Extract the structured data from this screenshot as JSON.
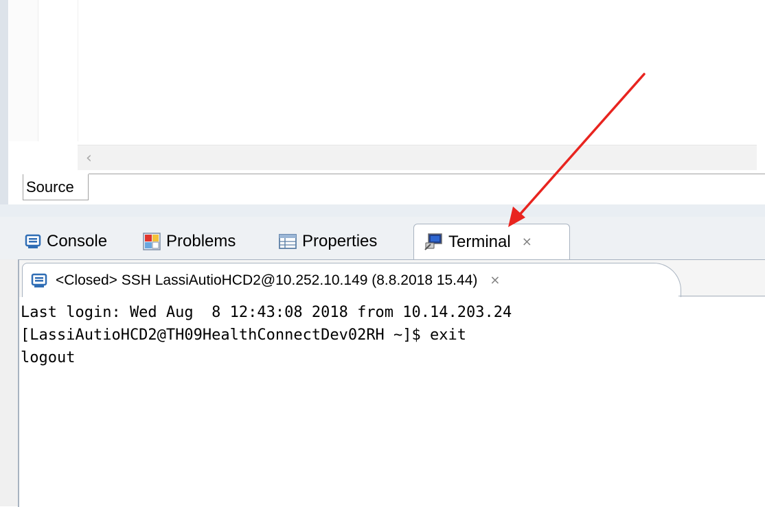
{
  "editor": {
    "scroll_left_glyph": "‹",
    "source_tab_label": "Source"
  },
  "views": {
    "tabs": [
      {
        "label": "Console",
        "icon": "console-icon"
      },
      {
        "label": "Problems",
        "icon": "problems-icon"
      },
      {
        "label": "Properties",
        "icon": "properties-icon"
      },
      {
        "label": "Terminal",
        "icon": "terminal-icon",
        "active": true
      }
    ],
    "close_glyph": "⨯"
  },
  "terminal": {
    "session_title": "<Closed> SSH LassiAutioHCD2@10.252.10.149 (8.8.2018 15.44)",
    "output": [
      "Last login: Wed Aug  8 12:43:08 2018 from 10.14.203.24",
      "[LassiAutioHCD2@TH09HealthConnectDev02RH ~]$ exit",
      "logout"
    ]
  },
  "colors": {
    "annotation_arrow": "#e8241f",
    "tab_border": "#a8b3c0",
    "console_icon": "#2f6db5"
  }
}
